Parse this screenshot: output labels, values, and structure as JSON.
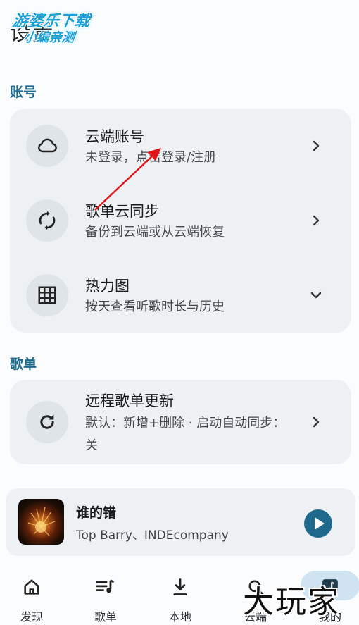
{
  "header": {
    "title": "设置"
  },
  "watermark_top": {
    "line1": "游婆乐下载",
    "line2": "小编亲测"
  },
  "watermark_bottom": "大玩家",
  "sections": {
    "account": {
      "title": "账号",
      "items": [
        {
          "title": "云端账号",
          "subtitle": "未登录，点击登录/注册",
          "icon": "cloud-icon",
          "trailing": "chevron-right-icon"
        },
        {
          "title": "歌单云同步",
          "subtitle": "备份到云端或从云端恢复",
          "icon": "sync-icon",
          "trailing": "chevron-right-icon"
        },
        {
          "title": "热力图",
          "subtitle": "按天查看听歌时长与历史",
          "icon": "grid-icon",
          "trailing": "chevron-down-icon"
        }
      ]
    },
    "playlist": {
      "title": "歌单",
      "items": [
        {
          "title": "远程歌单更新",
          "subtitle": "默认：新增+删除 · 启动自动同步：关",
          "icon": "refresh-icon",
          "trailing": "chevron-right-icon"
        }
      ]
    }
  },
  "player": {
    "song": "谁的错",
    "artist": "Top Barry、INDEcompany",
    "play_icon": "play-icon"
  },
  "nav": [
    {
      "label": "发现",
      "icon": "home-icon",
      "active": false
    },
    {
      "label": "歌单",
      "icon": "playlist-icon",
      "active": false
    },
    {
      "label": "本地",
      "icon": "download-icon",
      "active": false
    },
    {
      "label": "云端",
      "icon": "cloud-search-icon",
      "active": false
    },
    {
      "label": "我的",
      "icon": "music-note-icon",
      "active": true
    }
  ],
  "colors": {
    "accent": "#1f6a8c",
    "card": "#eef1f3",
    "active_pill": "#cfe4f0",
    "annotation_arrow": "#e0141a"
  }
}
